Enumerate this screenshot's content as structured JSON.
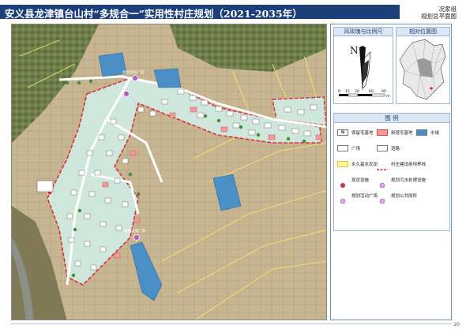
{
  "header": {
    "title": "安义县龙津镇台山村“多规合一”实用性村庄规划（2021-2035年）",
    "sub_group": "况家组",
    "sub_title": "规划总平面图"
  },
  "map_labels": {
    "plan_site_1": "规划活动广场",
    "plan_site_2": "规划活动广场"
  },
  "compass": {
    "title": "风玫瑰与比例尺",
    "north": "N",
    "scale_ticks": [
      "0",
      "15",
      "30",
      "60",
      "90"
    ],
    "scale_unit": "m"
  },
  "location": {
    "title": "相对位置图"
  },
  "legend": {
    "title": "图  例",
    "items": [
      {
        "label": "保留宅基地",
        "glyph": "保",
        "fill": "#ffffff"
      },
      {
        "label": "新增宅基地",
        "glyph": "",
        "fill": "#f29a9a"
      },
      {
        "label": "水域",
        "glyph": "",
        "fill": "#4a8fc6"
      },
      {
        "label": "广场",
        "glyph": "",
        "fill": "#ffffff"
      },
      {
        "label": "道路",
        "glyph": "",
        "fill": "#ffffff"
      },
      {
        "label": "永久基本农田",
        "glyph": "",
        "fill": "#fbf7a0"
      },
      {
        "label": "村庄建设用地界线",
        "glyph": "",
        "fill": "none"
      },
      {
        "label": "现状设施",
        "glyph": "",
        "fill": "none"
      },
      {
        "label": "规划污水处理设施",
        "glyph": "",
        "fill": "none"
      },
      {
        "label": "规划活动广场",
        "glyph": "",
        "fill": "none"
      },
      {
        "label": "规划公共厕所",
        "glyph": "",
        "fill": "none"
      }
    ]
  },
  "colors": {
    "water": "#4a8fc6",
    "village_land": "#cfe6dc",
    "boundary": "#d8323a",
    "farmland_line": "#f2ea6a",
    "header_band": "#1c3f7a",
    "plan_marker": "#b45bc9"
  },
  "page_number": "20"
}
